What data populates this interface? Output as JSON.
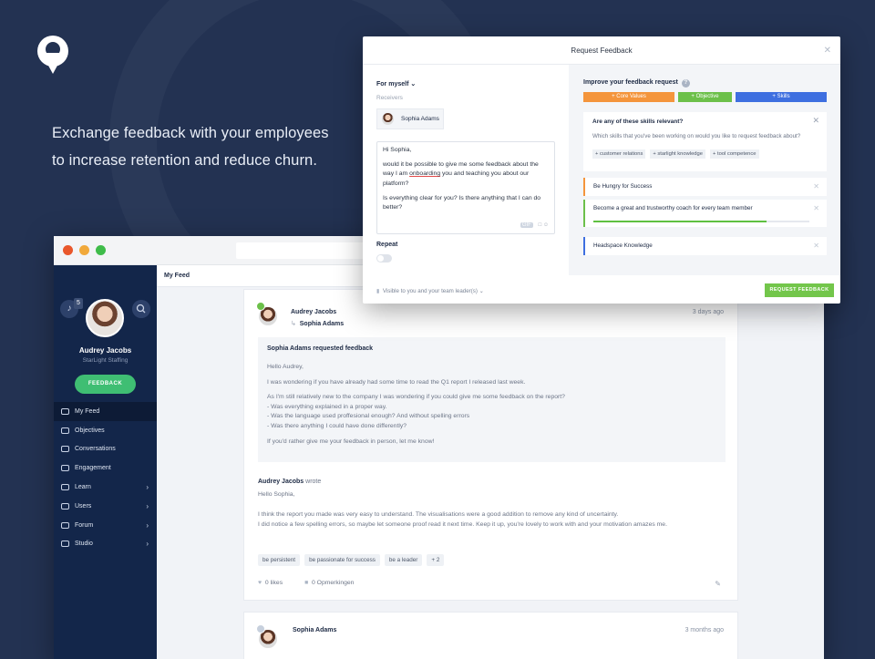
{
  "hero": {
    "line1": "Exchange feedback with your employees",
    "line2": "to increase retention and reduce churn."
  },
  "sidebar": {
    "notif_count": "5",
    "user_name": "Audrey Jacobs",
    "company": "StarLight Staffing",
    "feedback_button": "FEEDBACK",
    "items": [
      {
        "label": "My Feed",
        "icon": "feed-icon",
        "chevron": false,
        "active": true
      },
      {
        "label": "Objectives",
        "icon": "target-icon",
        "chevron": false
      },
      {
        "label": "Conversations",
        "icon": "conversations-icon",
        "chevron": false
      },
      {
        "label": "Engagement",
        "icon": "engagement-icon",
        "chevron": false
      },
      {
        "label": "Learn",
        "icon": "book-icon",
        "chevron": true
      },
      {
        "label": "Users",
        "icon": "users-icon",
        "chevron": true
      },
      {
        "label": "Forum",
        "icon": "forum-icon",
        "chevron": true
      },
      {
        "label": "Studio",
        "icon": "studio-icon",
        "chevron": true
      }
    ]
  },
  "topbar": {
    "title": "My Feed"
  },
  "post1": {
    "author": "Audrey Jacobs",
    "receiver": "Sophia Adams",
    "date": "3 days ago",
    "request_title": "Sophia Adams requested feedback",
    "request_greeting": "Hello Audrey,",
    "request_line1": "I was wondering if you have already had some time to read the Q1 report I released last week.",
    "request_line2": "As I'm still relatively new to the company I was wondering if you could give me some feedback on the report?",
    "request_line3": "- Was everything explained in a proper way.",
    "request_line4": "- Was the language used proffesional enough? And without spelling errors",
    "request_line5": "- Was there anything I could have done differently?",
    "request_line6": "If you'd rather give me your feedback in person, let me know!",
    "wrote_name": "Audrey Jacobs",
    "wrote_suffix": "wrote",
    "reply_greeting": "Hello Sophia,",
    "reply_line1": "I think the report you made was very easy to understand. The visualisations were a good addition to remove any kind of uncertainty.",
    "reply_line2": "I did notice a few spelling errors, so maybe let someone proof read it next time. Keep it up, you're lovely to work with and your motivation amazes me.",
    "tags": [
      "be persistent",
      "be passionate for success",
      "be a leader",
      "+ 2"
    ],
    "likes": "0 likes",
    "comments": "0 Opmerkingen"
  },
  "post2": {
    "author": "Sophia Adams",
    "date": "3 months ago"
  },
  "modal": {
    "title": "Request Feedback",
    "for_label": "For myself",
    "receivers_label": "Receivers",
    "receiver_name": "Sophia Adams",
    "message": {
      "greeting": "Hi Sophia,",
      "p1_before": "would it be possible to give me some feedback about the way I am ",
      "p1_word": "onboarding",
      "p1_after": " you and teaching you about our platform?",
      "p2": "Is everything clear for you? Is there anything that I can do better?",
      "gif": "GIF"
    },
    "repeat_label": "Repeat",
    "visibility": "Visible to you and your team leader(s)",
    "submit": "REQUEST FEEDBACK",
    "improve_title": "Improve your feedback request",
    "categories": [
      {
        "label": "Core Values",
        "color": "#f4953c"
      },
      {
        "label": "Objective",
        "color": "#6cc04a"
      },
      {
        "label": "Skills",
        "color": "#3e6fe0"
      }
    ],
    "skills_question": "Are any of these skills relevant?",
    "skills_desc": "Which skills that you've been working on would you like to request feedback about?",
    "skill_tags": [
      "+ customer relations",
      "+ starlight knowledge",
      "+ tool competence"
    ],
    "goals": [
      {
        "label": "Be Hungry for Success",
        "color": "#f4953c"
      },
      {
        "label": "Become a great and trustworthy coach for every team member",
        "color": "#6cc04a",
        "progress": 0.8
      },
      {
        "label": "Headspace Knowledge",
        "color": "#3e6fe0"
      }
    ]
  }
}
